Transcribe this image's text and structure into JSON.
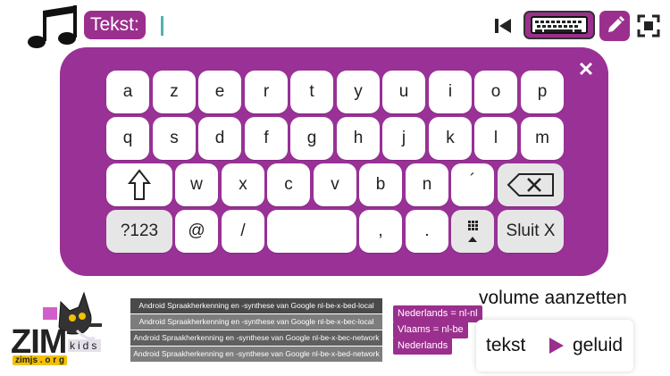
{
  "header": {
    "text_label": "Tekst:"
  },
  "keyboard": {
    "row1": [
      "a",
      "z",
      "e",
      "r",
      "t",
      "y",
      "u",
      "i",
      "o",
      "p"
    ],
    "row2": [
      "q",
      "s",
      "d",
      "f",
      "g",
      "h",
      "j",
      "k",
      "l",
      "m"
    ],
    "row3_letters": [
      "w",
      "x",
      "c",
      "v",
      "b",
      "n",
      "´"
    ],
    "numbers_key": "?123",
    "at_key": "@",
    "slash_key": "/",
    "comma_key": ",",
    "period_key": ".",
    "close_key": "Sluit X",
    "close_icon": "✕"
  },
  "voices": [
    "Android Spraakherkenning en -synthese van Google nl-be-x-bed-local",
    "Android Spraakherkenning en -synthese van Google nl-be-x-bec-local",
    "Android Spraakherkenning en -synthese van Google nl-be-x-bec-network",
    "Android Spraakherkenning en -synthese van Google nl-be-x-bed-network"
  ],
  "languages": [
    "Nederlands = nl-nl",
    "Vlaams = nl-be",
    "Nederlands"
  ],
  "volume_label": "volume aanzetten",
  "output_toggle": {
    "text_label": "tekst",
    "sound_label": "geluid"
  },
  "logo": {
    "brand": "ZIM",
    "letters": "kids",
    "tld": "zimjs . o r g"
  },
  "colors": {
    "accent": "#9b2f8e",
    "panel": "#993197"
  },
  "icons": [
    "music-notes-icon",
    "skip-back-icon",
    "keyboard-icon",
    "pencil-icon",
    "fullscreen-icon",
    "close-icon",
    "shift-icon",
    "backspace-icon",
    "keypad-icon",
    "play-icon",
    "cat-icon"
  ]
}
